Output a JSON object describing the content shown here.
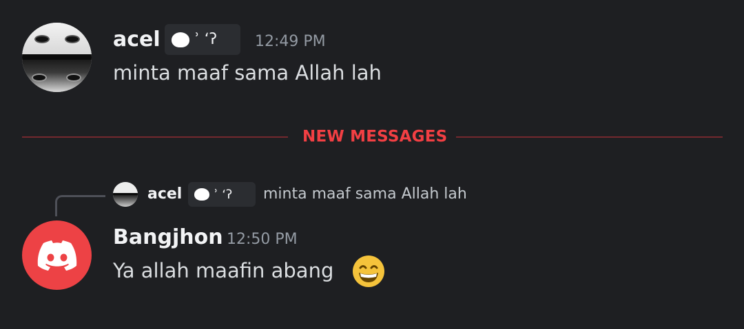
{
  "messages": [
    {
      "author": "acel",
      "tag_text": "ʾ ʻʔ",
      "timestamp": "12:49 PM",
      "text": "minta maaf sama Allah lah"
    }
  ],
  "divider": {
    "label": "NEW MESSAGES"
  },
  "reply": {
    "author": "acel",
    "tag_text": "ʾ ʻʔ",
    "text": "minta maaf sama Allah lah"
  },
  "second_message": {
    "author": "Bangjhon",
    "timestamp": "12:50 PM",
    "text": "Ya allah maafin abang"
  },
  "colors": {
    "background": "#1e1f22",
    "divider_red": "#f23f43",
    "discord_red": "#ed4245"
  },
  "icons": {
    "discord_avatar": "discord-logo-icon",
    "emoji": "grinning-face-emoji"
  }
}
